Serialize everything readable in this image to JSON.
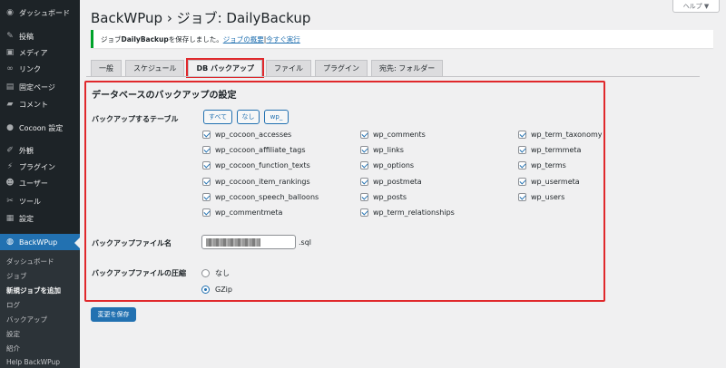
{
  "sidebar": {
    "items": [
      {
        "label": "ダッシュボード",
        "icon": "dashboard-icon",
        "glyph": "◉"
      },
      {
        "label": "投稿",
        "icon": "pin-icon",
        "glyph": "✎"
      },
      {
        "label": "メディア",
        "icon": "media-icon",
        "glyph": "▣"
      },
      {
        "label": "リンク",
        "icon": "link-icon",
        "glyph": "∞"
      },
      {
        "label": "固定ページ",
        "icon": "page-icon",
        "glyph": "▤"
      },
      {
        "label": "コメント",
        "icon": "comment-icon",
        "glyph": "▰"
      },
      {
        "label": "Cocoon 設定",
        "icon": "cocoon-icon",
        "glyph": "●"
      },
      {
        "label": "外観",
        "icon": "appearance-icon",
        "glyph": "✐"
      },
      {
        "label": "プラグイン",
        "icon": "plugin-icon",
        "glyph": "⚡"
      },
      {
        "label": "ユーザー",
        "icon": "user-icon",
        "glyph": "☻"
      },
      {
        "label": "ツール",
        "icon": "tool-icon",
        "glyph": "✂"
      },
      {
        "label": "設定",
        "icon": "settings-icon",
        "glyph": "▦"
      },
      {
        "label": "BackWPup",
        "icon": "backwpup-icon",
        "glyph": "◍"
      }
    ],
    "submenu": [
      "ダッシュボード",
      "ジョブ",
      "新規ジョブを追加",
      "ログ",
      "バックアップ",
      "設定",
      "紹介",
      "Help BackWPup"
    ]
  },
  "header": {
    "help_label": "ヘルプ ▼",
    "title": "BackWPup › ジョブ: DailyBackup"
  },
  "notice": {
    "prefix": "ジョブ ",
    "job_name": "DailyBackup",
    "middle": " を保存しました。",
    "overview_link": "ジョブの概要",
    "separator": " | ",
    "run_link": "今すぐ実行"
  },
  "tabs": [
    {
      "label": "一般",
      "active": false
    },
    {
      "label": "スケジュール",
      "active": false
    },
    {
      "label": "DB バックアップ",
      "active": true
    },
    {
      "label": "ファイル",
      "active": false
    },
    {
      "label": "プラグイン",
      "active": false
    },
    {
      "label": "宛先: フォルダー",
      "active": false
    }
  ],
  "section": {
    "title": "データベースのバックアップの設定",
    "tables_label": "バックアップするテーブル",
    "select_buttons": [
      "すべて",
      "なし",
      "wp_"
    ],
    "tables": [
      {
        "name": "wp_cocoon_accesses",
        "checked": true
      },
      {
        "name": "wp_comments",
        "checked": true
      },
      {
        "name": "wp_term_taxonomy",
        "checked": true
      },
      {
        "name": "wp_cocoon_affiliate_tags",
        "checked": true
      },
      {
        "name": "wp_links",
        "checked": true
      },
      {
        "name": "wp_termmeta",
        "checked": true
      },
      {
        "name": "wp_cocoon_function_texts",
        "checked": true
      },
      {
        "name": "wp_options",
        "checked": true
      },
      {
        "name": "wp_terms",
        "checked": true
      },
      {
        "name": "wp_cocoon_item_rankings",
        "checked": true
      },
      {
        "name": "wp_postmeta",
        "checked": true
      },
      {
        "name": "wp_usermeta",
        "checked": true
      },
      {
        "name": "wp_cocoon_speech_balloons",
        "checked": true
      },
      {
        "name": "wp_posts",
        "checked": true
      },
      {
        "name": "wp_users",
        "checked": true
      },
      {
        "name": "wp_commentmeta",
        "checked": true
      },
      {
        "name": "wp_term_relationships",
        "checked": true
      }
    ],
    "filename_label": "バックアップファイル名",
    "filename_suffix": ".sql",
    "compression_label": "バックアップファイルの圧縮",
    "compression_options": [
      {
        "label": "なし",
        "selected": false
      },
      {
        "label": "GZip",
        "selected": true
      }
    ]
  },
  "save_label": "変更を保存",
  "colors": {
    "accent": "#2271b1",
    "highlight": "#e0282c",
    "sidebar": "#1d2327",
    "success": "#00a32a"
  }
}
